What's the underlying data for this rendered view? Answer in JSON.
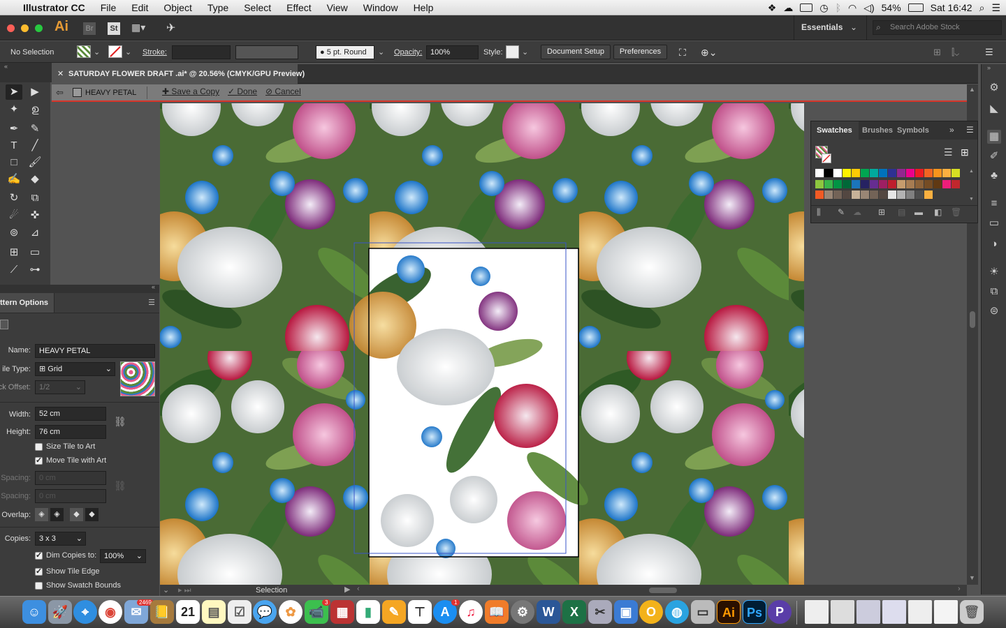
{
  "menubar": {
    "apple": "",
    "app_name": "Illustrator CC",
    "items": [
      "File",
      "Edit",
      "Object",
      "Type",
      "Select",
      "Effect",
      "View",
      "Window",
      "Help"
    ],
    "battery": "54%",
    "clock": "Sat 16:42"
  },
  "appbar": {
    "ai_logo": "Ai",
    "br_logo": "Br",
    "st_logo": "St",
    "workspace": "Essentials",
    "stock_search_placeholder": "Search Adobe Stock"
  },
  "control": {
    "selection": "No Selection",
    "stroke_label": "Stroke:",
    "brush": "5 pt. Round",
    "opacity_label": "Opacity:",
    "opacity_value": "100%",
    "style_label": "Style:",
    "document_setup": "Document Setup",
    "preferences": "Preferences"
  },
  "document": {
    "tab_title": "SATURDAY FLOWER DRAFT .ai* @ 20.56% (CMYK/GPU Preview)"
  },
  "isolation": {
    "pattern_name": "HEAVY PETAL",
    "save_copy": "Save a Copy",
    "done": "Done",
    "cancel": "Cancel"
  },
  "pattern_options": {
    "title": "ttern Options",
    "name_label": "Name:",
    "name_value": "HEAVY PETAL",
    "tile_type_label": "ile Type:",
    "tile_type_value": "Grid",
    "brick_offset_label": "ck Offset:",
    "brick_offset_value": "1/2",
    "width_label": "Width:",
    "width_value": "52 cm",
    "height_label": "Height:",
    "height_value": "76 cm",
    "size_tile_to_art": "Size Tile to Art",
    "size_tile_to_art_checked": false,
    "move_tile_with_art": "Move Tile with Art",
    "move_tile_with_art_checked": true,
    "h_spacing_label": "Spacing:",
    "h_spacing_value": "0 cm",
    "v_spacing_label": "Spacing:",
    "v_spacing_value": "0 cm",
    "overlap_label": "Overlap:",
    "copies_label": "Copies:",
    "copies_value": "3 x 3",
    "dim_copies_label": "Dim Copies to:",
    "dim_copies_checked": true,
    "dim_copies_value": "100%",
    "show_tile_edge": "Show Tile Edge",
    "show_tile_edge_checked": true,
    "show_swatch_bounds": "Show Swatch Bounds",
    "show_swatch_bounds_checked": false
  },
  "swatches_panel": {
    "tabs": [
      "Swatches",
      "Brushes",
      "Symbols"
    ],
    "active_tab": "Swatches",
    "colors": [
      "#ffffff",
      "#000000",
      "#ffffff",
      "#fff200",
      "#ffcb05",
      "#00a651",
      "#00a99d",
      "#0072bc",
      "#2e3192",
      "#92278f",
      "#ec008c",
      "#ed1c24",
      "#f26522",
      "#f7941d",
      "#fbb040",
      "#d7df23",
      "#8dc63f",
      "#39b54a",
      "#009444",
      "#006838",
      "#1b75bc",
      "#262262",
      "#662d91",
      "#9e1f63",
      "#be1e2d",
      "#c69c6d",
      "#a67c52",
      "#8c6239",
      "#754c24",
      "#603913",
      "#ed1e79",
      "#c1272d",
      "#f15a24",
      "#998675",
      "#736357",
      "#534741",
      "#c7b299",
      "#998675",
      "#736357",
      "#534741",
      "#e6e6e6",
      "#b3b3b3",
      "#808080",
      "#4d4d4d",
      "#fbb040"
    ]
  },
  "status": {
    "tool_name": "Selection"
  },
  "colors": {
    "isolation_border": "#d8352a",
    "tile_border": "#3a55c8"
  },
  "dock": {
    "mail_badge": "2469",
    "calendar_day": "21",
    "facetime_badge": "3",
    "appstore_badge": "1"
  }
}
